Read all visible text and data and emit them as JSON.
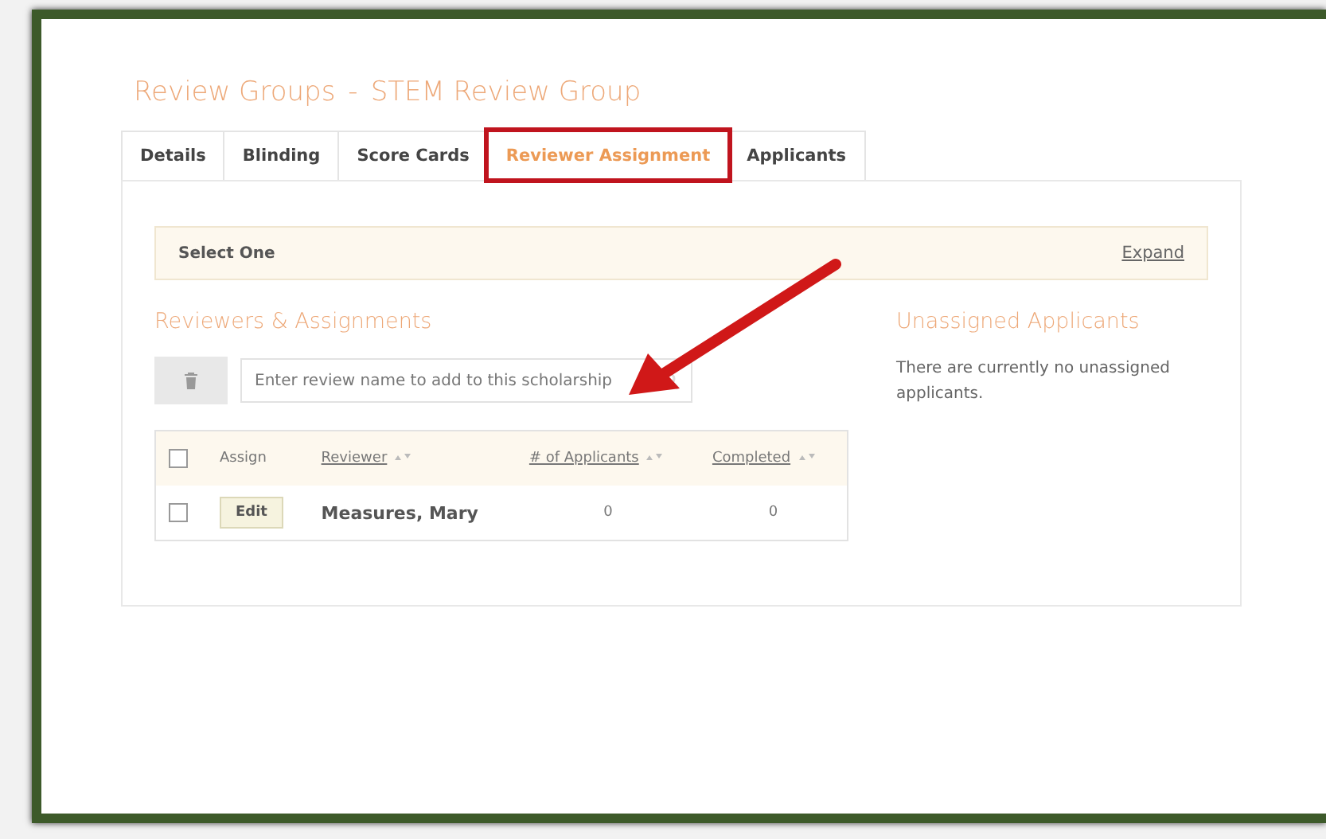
{
  "page_title": {
    "section": "Review Groups",
    "separator": "-",
    "group": "STEM Review Group"
  },
  "tabs": [
    {
      "label": "Details",
      "selected": false,
      "highlighted": false
    },
    {
      "label": "Blinding",
      "selected": false,
      "highlighted": false
    },
    {
      "label": "Score Cards",
      "selected": false,
      "highlighted": false
    },
    {
      "label": "Reviewer Assignment",
      "selected": true,
      "highlighted": true
    },
    {
      "label": "Applicants",
      "selected": false,
      "highlighted": false
    }
  ],
  "select_bar": {
    "label": "Select One",
    "link": "Expand"
  },
  "reviewers": {
    "heading": "Reviewers & Assignments",
    "search": {
      "placeholder": "Enter review name to add to this scholarship"
    },
    "table": {
      "header_checked": false,
      "columns": [
        {
          "label": "Assign",
          "sortable": false
        },
        {
          "label": "Reviewer",
          "sortable": true
        },
        {
          "label": "# of Applicants",
          "sortable": true
        },
        {
          "label": "Completed",
          "sortable": true
        }
      ],
      "rows": [
        {
          "checked": false,
          "action": "Edit",
          "reviewer": "Measures, Mary",
          "applicants": "0",
          "completed": "0"
        }
      ]
    }
  },
  "unassigned": {
    "heading": "Unassigned Applicants",
    "message": "There are currently no unassigned applicants."
  }
}
